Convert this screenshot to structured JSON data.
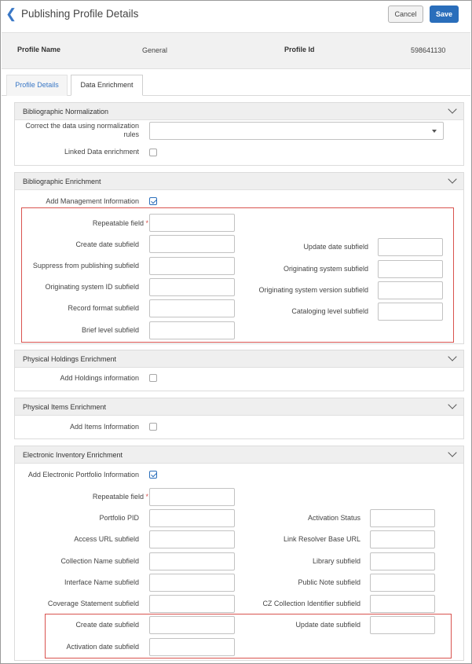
{
  "header": {
    "title": "Publishing Profile Details",
    "cancel_label": "Cancel",
    "save_label": "Save"
  },
  "info": {
    "profile_name_label": "Profile Name",
    "profile_name_value": "General",
    "profile_id_label": "Profile Id",
    "profile_id_value": "598641130"
  },
  "tabs": [
    {
      "label": "Profile Details"
    },
    {
      "label": "Data Enrichment"
    }
  ],
  "bib_norm": {
    "title": "Bibliographic Normalization",
    "correct_label_1": "Correct the data using normalization",
    "correct_label_2": "rules",
    "correct_value": "",
    "linked_label": "Linked Data enrichment",
    "linked_checked": false
  },
  "bib_enrich": {
    "title": "Bibliographic Enrichment",
    "add_mgmt_label": "Add Management Information",
    "add_mgmt_checked": true,
    "repeatable_label": "Repeatable field",
    "required_mark": "*",
    "left_fields": [
      "Create date subfield",
      "Suppress from publishing subfield",
      "Originating system ID subfield",
      "Record format subfield",
      "Brief level subfield"
    ],
    "right_fields": [
      "Update date subfield",
      "Originating system subfield",
      "Originating system version subfield",
      "Cataloging level subfield"
    ]
  },
  "holdings": {
    "title": "Physical Holdings Enrichment",
    "label": "Add Holdings information",
    "checked": false
  },
  "items": {
    "title": "Physical Items Enrichment",
    "label": "Add Items Information",
    "checked": false
  },
  "electronic": {
    "title": "Electronic Inventory Enrichment",
    "add_label": "Add Electronic Portfolio Information",
    "add_checked": true,
    "repeatable_label": "Repeatable field",
    "required_mark": "*",
    "left_fields": [
      "Portfolio PID",
      "Access URL subfield",
      "Collection Name subfield",
      "Interface Name subfield",
      "Coverage Statement subfield",
      "Create date subfield",
      "Activation date subfield"
    ],
    "right_fields": [
      "Activation Status",
      "Link Resolver Base URL",
      "Library subfield",
      "Public Note subfield",
      "CZ Collection Identifier subfield",
      "Update date subfield"
    ]
  }
}
